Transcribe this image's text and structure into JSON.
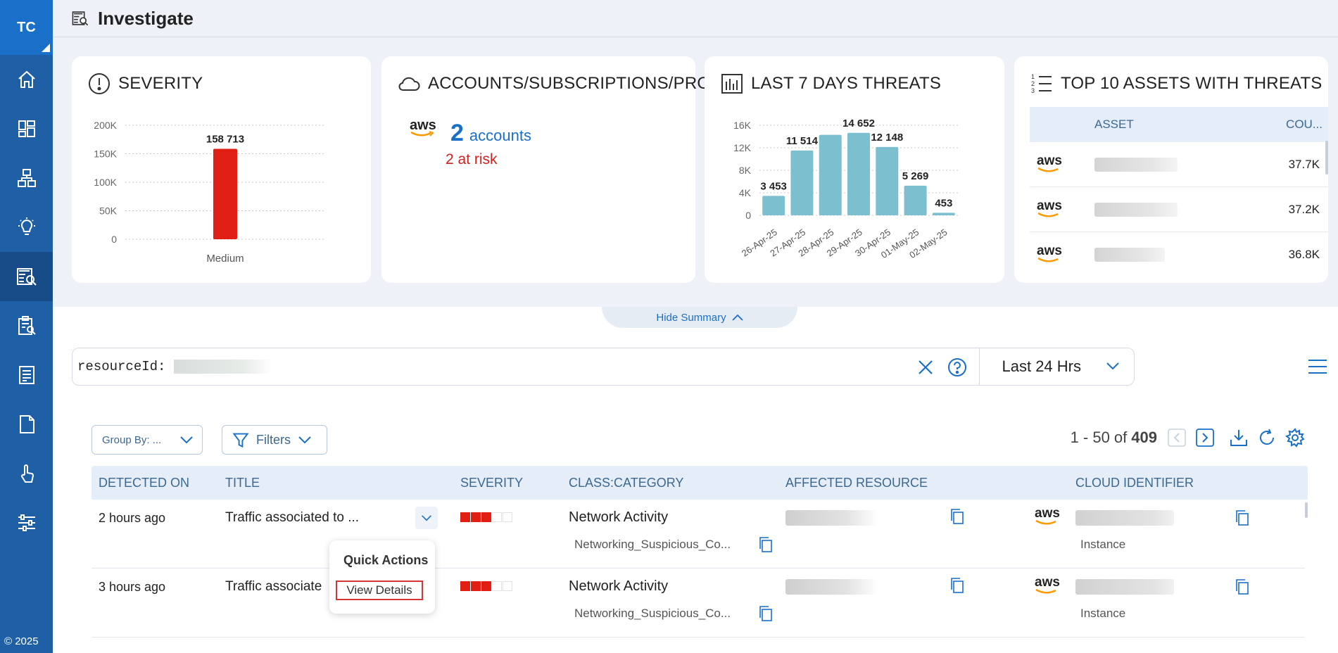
{
  "sidebar": {
    "logo": "TC",
    "copyright": "© 2025",
    "items": [
      {
        "icon": "home-icon"
      },
      {
        "icon": "dashboard-icon"
      },
      {
        "icon": "hierarchy-icon"
      },
      {
        "icon": "lightbulb-icon"
      },
      {
        "icon": "investigate-icon",
        "active": true
      },
      {
        "icon": "clipboard-search-icon"
      },
      {
        "icon": "report-icon"
      },
      {
        "icon": "document-icon"
      },
      {
        "icon": "touch-icon"
      },
      {
        "icon": "sliders-icon"
      }
    ]
  },
  "header": {
    "title": "Investigate"
  },
  "cards": {
    "severity": {
      "title": "SEVERITY"
    },
    "accounts": {
      "title": "ACCOUNTS/SUBSCRIPTIONS/PROJECTS",
      "count": "2",
      "label": "accounts",
      "risk": "2 at risk",
      "provider": "aws"
    },
    "threats": {
      "title": "LAST 7 DAYS THREATS"
    },
    "top_assets": {
      "title": "TOP 10 ASSETS WITH THREATS",
      "columns": [
        "ASSET",
        "COU..."
      ],
      "rows": [
        {
          "provider": "aws",
          "count": "37.7K"
        },
        {
          "provider": "aws",
          "count": "37.2K"
        },
        {
          "provider": "aws",
          "count": "36.8K"
        }
      ]
    }
  },
  "chart_data": [
    {
      "type": "bar",
      "categories": [
        "Medium"
      ],
      "values": [
        158713
      ],
      "data_labels": [
        "158 713"
      ],
      "y_ticks": [
        "200K",
        "150K",
        "100K",
        "50K",
        "0"
      ],
      "ylim": [
        0,
        200000
      ],
      "color": "#e01e13",
      "grid": true
    },
    {
      "type": "bar",
      "categories": [
        "26-Apr-25",
        "27-Apr-25",
        "28-Apr-25",
        "29-Apr-25",
        "30-Apr-25",
        "01-May-25",
        "02-May-25"
      ],
      "values": [
        3453,
        11514,
        14300,
        14652,
        12148,
        5269,
        453
      ],
      "data_labels": [
        "3 453",
        "11 514",
        "",
        "14 652",
        "12 148",
        "5 269",
        "453"
      ],
      "y_ticks": [
        "16K",
        "12K",
        "8K",
        "4K",
        "0"
      ],
      "ylim": [
        0,
        16000
      ],
      "color": "#7cbfcf",
      "grid": true
    }
  ],
  "hide_summary": "Hide Summary",
  "search": {
    "query_key": "resourceId:",
    "time_range": "Last 24 Hrs"
  },
  "toolbar": {
    "group_by": "Group By: ...",
    "filters": "Filters",
    "range": "1 - 50 of",
    "total": "409"
  },
  "table": {
    "columns": [
      "DETECTED ON",
      "TITLE",
      "SEVERITY",
      "CLASS:CATEGORY",
      "AFFECTED RESOURCE",
      "CLOUD IDENTIFIER"
    ],
    "rows": [
      {
        "detected": "2 hours ago",
        "title": "Traffic associated to ...",
        "severity_level": 3,
        "class": "Network Activity",
        "category": "Networking_Suspicious_Co...",
        "provider": "aws",
        "cloud_type": "Instance"
      },
      {
        "detected": "3 hours ago",
        "title": "Traffic associate",
        "severity_level": 3,
        "class": "Network Activity",
        "category": "Networking_Suspicious_Co...",
        "provider": "aws",
        "cloud_type": "Instance"
      }
    ]
  },
  "quick_actions": {
    "title": "Quick Actions",
    "view_details": "View Details"
  },
  "colors": {
    "sidebar": "#1f5fa6",
    "accent": "#1a6fc9",
    "danger": "#e01e13",
    "bar": "#7cbfcf"
  }
}
